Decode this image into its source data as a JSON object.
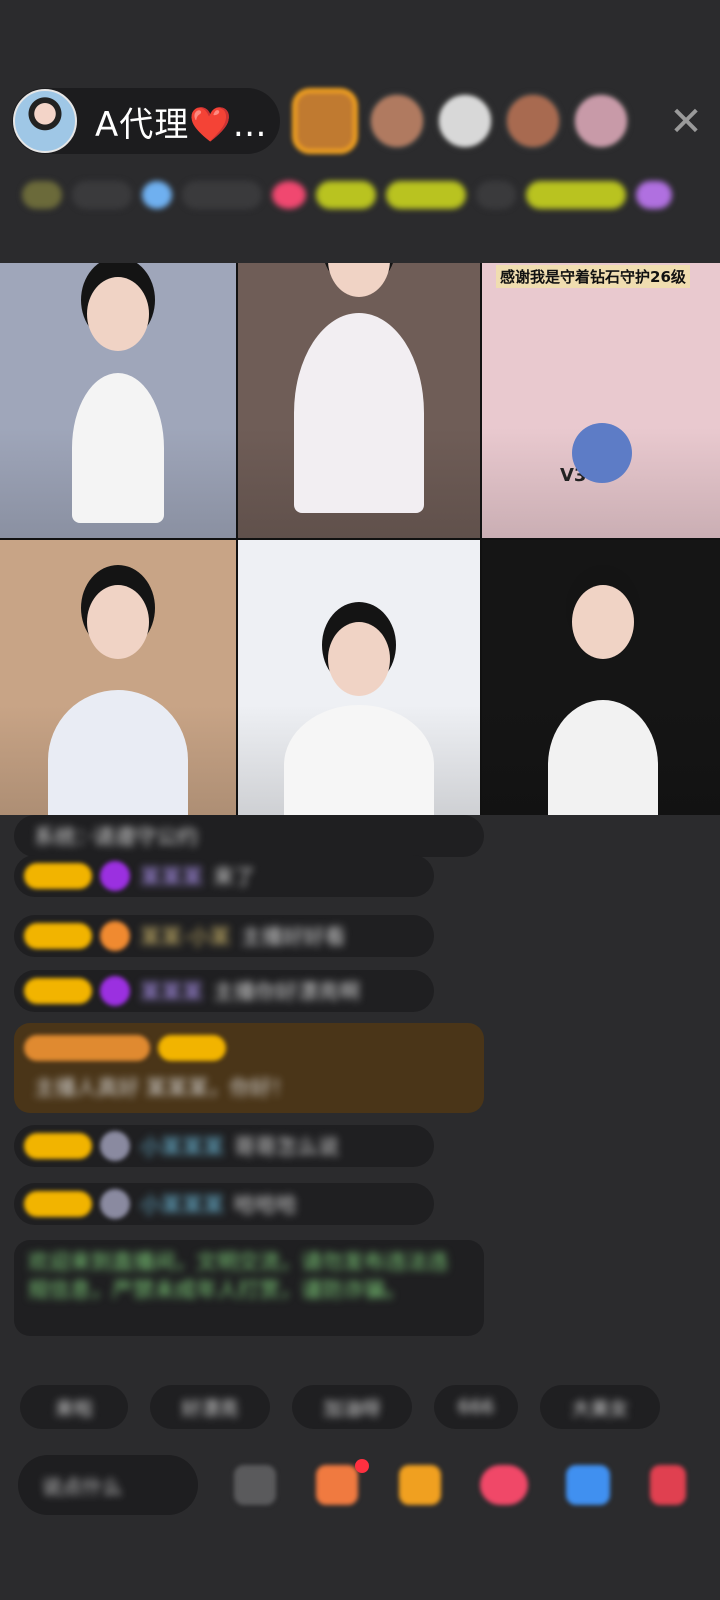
{
  "header": {
    "host_name": "A代理",
    "host_heart": "❤️",
    "host_ellipsis": "…",
    "viewers": [
      {
        "name": "viewer-1",
        "color": "#c07a30",
        "ring": "#f0a020"
      },
      {
        "name": "viewer-2",
        "color": "#b07a60",
        "ring": "#3a3a3a"
      },
      {
        "name": "viewer-3",
        "color": "#d8d8d8",
        "ring": "#3a3a3a"
      },
      {
        "name": "viewer-4",
        "color": "#a86a50",
        "ring": "#3a3a3a"
      },
      {
        "name": "viewer-5",
        "color": "#c89aa8",
        "ring": "#3a3a3a"
      }
    ],
    "close_icon": "✕"
  },
  "video_grid": {
    "tiles": [
      {
        "bg": "#9fa6ba",
        "accent": "#f4f4f4",
        "text": ""
      },
      {
        "bg": "#6f5d57",
        "accent": "#f2eef2",
        "text": ""
      },
      {
        "bg": "#e9c9cf",
        "accent": "#5d7cc6",
        "text": "感谢我是守着钻石守护26级",
        "mark": "V3V5"
      },
      {
        "bg": "#c8a486",
        "accent": "#e9ecf4",
        "text": ""
      },
      {
        "bg": "#eef0f4",
        "accent": "#f6f6f6",
        "text": ""
      },
      {
        "bg": "#151515",
        "accent": "#f2f2f2",
        "text": ""
      }
    ]
  },
  "chat": {
    "messages": [
      {
        "text": "系统：·请遵守公约"
      },
      {
        "name": "某某某",
        "body": "来了",
        "gem": "#9b30e0"
      },
      {
        "name": "某某·小某",
        "body": "主播好好看",
        "gem": "#f08a30"
      },
      {
        "name": "某某某",
        "body": "主播你好漂亮啊",
        "gem": "#9b30e0"
      },
      {
        "name": "某某某",
        "body": "主播人真好 某某某，你好！"
      },
      {
        "name": "小某某某",
        "body": "哥哥怎么说",
        "gem": "#8a8aa0"
      },
      {
        "name": "小某某某",
        "body": "哈哈哈",
        "gem": "#8a8aa0"
      },
      {
        "text": "欢迎来到直播间，文明交流，请勿发布违法违规信息，严禁未成年人打赏，谨防诈骗。"
      }
    ]
  },
  "quick_actions": [
    "来啦",
    "好漂亮",
    "加油呀",
    "666",
    "大美女"
  ],
  "bottom_bar": {
    "say_placeholder": "说点什么",
    "icons": [
      {
        "name": "more-icon",
        "color": "#5a5a5c"
      },
      {
        "name": "gift-bag-icon",
        "color": "#f07a40"
      },
      {
        "name": "treasure-icon",
        "color": "#f0a020"
      },
      {
        "name": "game-icon",
        "color": "#f04868"
      },
      {
        "name": "chat-bubble-icon",
        "color": "#4090f0"
      },
      {
        "name": "gift-icon",
        "color": "#e04050"
      }
    ]
  }
}
